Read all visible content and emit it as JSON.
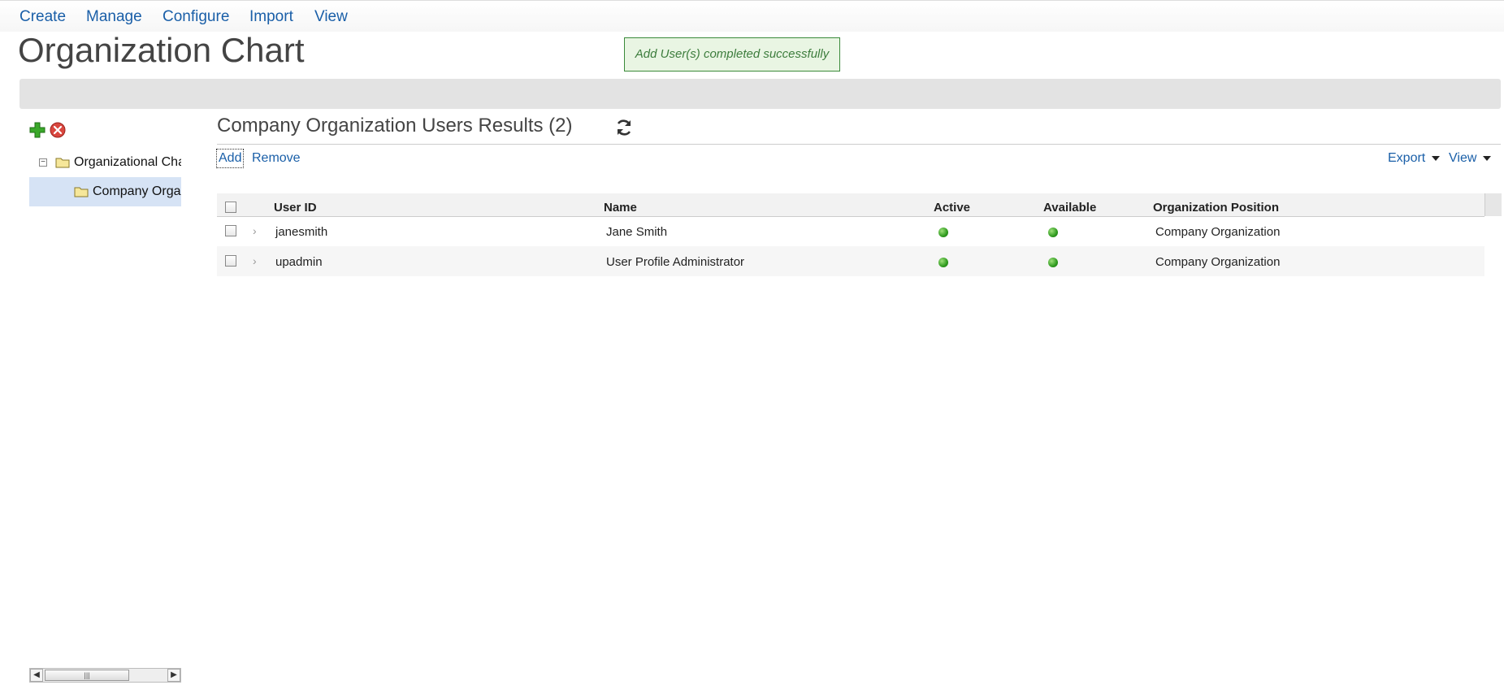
{
  "menu": {
    "items": [
      "Create",
      "Manage",
      "Configure",
      "Import",
      "View"
    ]
  },
  "page": {
    "title": "Organization Chart"
  },
  "notification": {
    "message": "Add User(s) completed successfully"
  },
  "tree": {
    "tools": [
      "add-icon",
      "delete-icon"
    ],
    "nodes": [
      {
        "label": "Organizational Chart",
        "expanded": true
      },
      {
        "label": "Company Organization",
        "selected": true
      }
    ]
  },
  "results": {
    "title": "Company Organization Users Results (2)",
    "actions": {
      "add": "Add",
      "remove": "Remove"
    },
    "menus": {
      "export": "Export",
      "view": "View"
    },
    "columns": [
      "User ID",
      "Name",
      "Active",
      "Available",
      "Organization Position"
    ],
    "rows": [
      {
        "user_id": "janesmith",
        "name": "Jane Smith",
        "active": true,
        "available": true,
        "position": "Company Organization"
      },
      {
        "user_id": "upadmin",
        "name": "User Profile Administrator",
        "active": true,
        "available": true,
        "position": "Company Organization"
      }
    ],
    "status_color": "#2f9b1f"
  }
}
